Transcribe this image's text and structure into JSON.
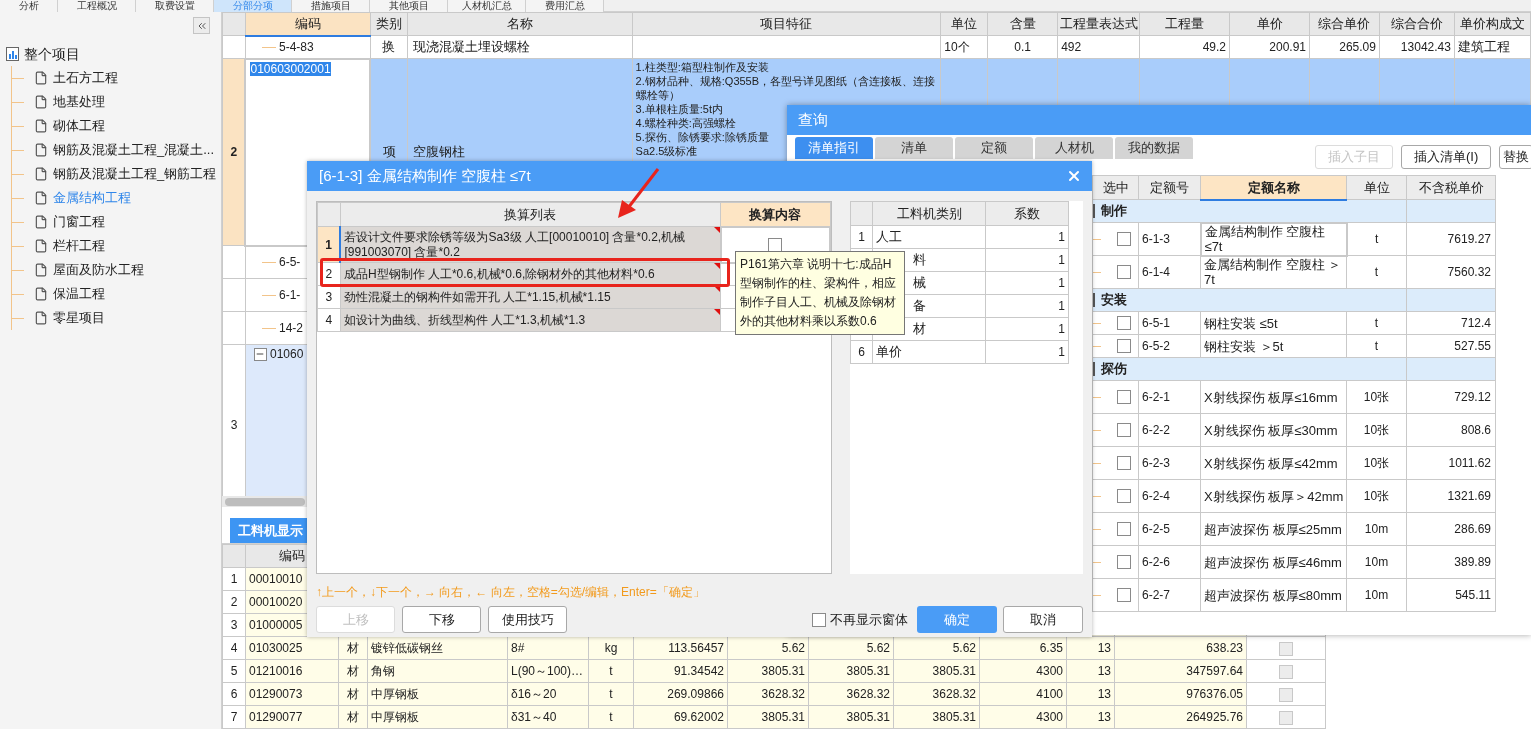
{
  "top_tabs": [
    {
      "label": "分析",
      "selected": false
    },
    {
      "label": "工程概况",
      "selected": false
    },
    {
      "label": "取费设置",
      "selected": false
    },
    {
      "label": "分部分项",
      "selected": true
    },
    {
      "label": "措施项目",
      "selected": false
    },
    {
      "label": "其他项目",
      "selected": false
    },
    {
      "label": "人材机汇总",
      "selected": false
    },
    {
      "label": "费用汇总",
      "selected": false
    }
  ],
  "sidebar": {
    "tree": [
      {
        "label": "整个项目",
        "selected": false,
        "children": [
          {
            "label": "土石方工程",
            "selected": false
          },
          {
            "label": "地基处理",
            "selected": false
          },
          {
            "label": "砌体工程",
            "selected": false
          },
          {
            "label": "钢筋及混凝土工程_混凝土...",
            "selected": false
          },
          {
            "label": "钢筋及混凝土工程_钢筋工程",
            "selected": false
          },
          {
            "label": "金属结构工程",
            "selected": true
          },
          {
            "label": "门窗工程",
            "selected": false
          },
          {
            "label": "栏杆工程",
            "selected": false
          },
          {
            "label": "屋面及防水工程",
            "selected": false
          },
          {
            "label": "保温工程",
            "selected": false
          },
          {
            "label": "零星项目",
            "selected": false
          }
        ]
      }
    ]
  },
  "main_grid": {
    "columns": [
      "编码",
      "类别",
      "名称",
      "项目特征",
      "单位",
      "含量",
      "工程量表达式",
      "工程量",
      "单价",
      "综合单价",
      "综合合价",
      "单价构成文"
    ],
    "rows": [
      {
        "kind": "sub",
        "code": "5-4-83",
        "type": "换",
        "name": "现浇混凝土埋设螺栓",
        "unit": "10个",
        "content": "0.1",
        "expression": "492",
        "quantity": "49.2",
        "price": "200.91",
        "unit_price": "265.09",
        "total": "13042.43",
        "file": "建筑工程",
        "selected": false
      },
      {
        "kind": "item",
        "num": "2",
        "code": "010603002001",
        "type": "项",
        "name": "空腹钢柱",
        "features": [
          "1.柱类型:箱型柱制作及安装",
          "2.钢材品种、规格:Q355B，各型号详见图纸（含连接板、连接螺栓等）",
          "3.单根柱质量:5t内",
          "4.螺栓种类:高强螺栓",
          "5.探伤、除锈要求:除锈质量",
          "Sa2.5级标准"
        ],
        "selected": true
      },
      {
        "kind": "sub",
        "code": "6-5-",
        "selected": false
      },
      {
        "kind": "sub",
        "code": "6-1-",
        "selected": false
      },
      {
        "kind": "sub",
        "code": "14-2",
        "selected": false
      },
      {
        "kind": "item",
        "num": "3",
        "code": "01060",
        "expanded": true,
        "selected": false
      }
    ]
  },
  "bottom_panel": {
    "tab": "工料机显示",
    "columns": [
      "编码"
    ],
    "rows": [
      {
        "num": "1",
        "cells": [
          "00010010"
        ]
      },
      {
        "num": "2",
        "cells": [
          "00010020"
        ]
      },
      {
        "num": "3",
        "cells": [
          "01000005"
        ]
      },
      {
        "num": "4",
        "cells": [
          "01030025",
          "材",
          "镀锌低碳钢丝",
          "8#",
          "kg",
          "113.56457",
          "5.62",
          "5.62",
          "5.62",
          "6.35",
          "13",
          "638.23"
        ],
        "checked": false
      },
      {
        "num": "5",
        "cells": [
          "01210016",
          "材",
          "角钢",
          "L(90～100)…",
          "t",
          "91.34542",
          "3805.31",
          "3805.31",
          "3805.31",
          "4300",
          "13",
          "347597.64"
        ],
        "checked": false
      },
      {
        "num": "6",
        "cells": [
          "01290073",
          "材",
          "中厚钢板",
          "δ16～20",
          "t",
          "269.09866",
          "3628.32",
          "3628.32",
          "3628.32",
          "4100",
          "13",
          "976376.05"
        ],
        "checked": false
      },
      {
        "num": "7",
        "cells": [
          "01290077",
          "材",
          "中厚钢板",
          "δ31～40",
          "t",
          "69.62002",
          "3805.31",
          "3805.31",
          "3805.31",
          "4300",
          "13",
          "264925.76"
        ],
        "checked": false
      }
    ]
  },
  "query_window": {
    "title": "查询",
    "tabs": [
      {
        "label": "清单指引",
        "selected": true
      },
      {
        "label": "清单",
        "selected": false
      },
      {
        "label": "定额",
        "selected": false
      },
      {
        "label": "人材机",
        "selected": false
      },
      {
        "label": "我的数据",
        "selected": false
      }
    ],
    "buttons": [
      {
        "label": "插入子目",
        "disabled": true
      },
      {
        "label": "插入清单(I)",
        "disabled": false
      },
      {
        "label": "替换",
        "disabled": false
      }
    ],
    "columns": [
      "选中",
      "定额号",
      "定额名称",
      "单位",
      "不含税单价"
    ],
    "groups": [
      {
        "label": "制作",
        "items": [
          {
            "code": "6-1-3",
            "name": "金属结构制作 空腹柱 ≤7t",
            "unit": "t",
            "price": "7619.27",
            "checked": false,
            "selected": true
          },
          {
            "code": "6-1-4",
            "name": "金属结构制作 空腹柱 ＞7t",
            "unit": "t",
            "price": "7560.32",
            "checked": false,
            "selected": false
          }
        ]
      },
      {
        "label": "安装",
        "items": [
          {
            "code": "6-5-1",
            "name": "钢柱安装 ≤5t",
            "unit": "t",
            "price": "712.4",
            "checked": false,
            "selected": false
          },
          {
            "code": "6-5-2",
            "name": "钢柱安装 ＞5t",
            "unit": "t",
            "price": "527.55",
            "checked": false,
            "selected": false
          }
        ]
      },
      {
        "label": "探伤",
        "items": [
          {
            "code": "6-2-1",
            "name": "X射线探伤 板厚≤16mm",
            "unit": "10张",
            "price": "729.12",
            "checked": false,
            "selected": false
          },
          {
            "code": "6-2-2",
            "name": "X射线探伤 板厚≤30mm",
            "unit": "10张",
            "price": "808.6",
            "checked": false,
            "selected": false
          },
          {
            "code": "6-2-3",
            "name": "X射线探伤 板厚≤42mm",
            "unit": "10张",
            "price": "1011.62",
            "checked": false,
            "selected": false
          },
          {
            "code": "6-2-4",
            "name": "X射线探伤 板厚＞42mm",
            "unit": "10张",
            "price": "1321.69",
            "checked": false,
            "selected": false
          },
          {
            "code": "6-2-5",
            "name": "超声波探伤 板厚≤25mm",
            "unit": "10m",
            "price": "286.69",
            "checked": false,
            "selected": false
          },
          {
            "code": "6-2-6",
            "name": "超声波探伤 板厚≤46mm",
            "unit": "10m",
            "price": "389.89",
            "checked": false,
            "selected": false
          },
          {
            "code": "6-2-7",
            "name": "超声波探伤 板厚≤80mm",
            "unit": "10m",
            "price": "545.11",
            "checked": false,
            "selected": false
          }
        ]
      }
    ]
  },
  "conversion_dialog": {
    "title": "[6-1-3] 金属结构制作 空腹柱 ≤7t",
    "list_columns": [
      "换算列表",
      "换算内容"
    ],
    "rows": [
      {
        "num": "1",
        "text": "若设计文件要求除锈等级为Sa3级 人工[00010010] 含量*0.2,机械[991003070] 含量*0.2",
        "selected": true,
        "checked": false
      },
      {
        "num": "2",
        "text": "成品H型钢制作 人工*0.6,机械*0.6,除钢材外的其他材料*0.6",
        "selected": false
      },
      {
        "num": "3",
        "text": "劲性混凝土的钢构件如需开孔 人工*1.15,机械*1.15",
        "selected": false
      },
      {
        "num": "4",
        "text": "如设计为曲线、折线型构件 人工*1.3,机械*1.3",
        "selected": false
      }
    ],
    "tooltip": "P161第六章 说明十七:成品H型钢制作的柱、梁构件，相应制作子目人工、机械及除钢材外的其他材料乘以系数0.6",
    "factor_columns": [
      "工料机类别",
      "系数"
    ],
    "factors": [
      {
        "num": "1",
        "label": "人工",
        "value": "1"
      },
      {
        "label": "料",
        "value": "1"
      },
      {
        "label": "械",
        "value": "1"
      },
      {
        "label": "备",
        "value": "1"
      },
      {
        "label": "材",
        "value": "1"
      },
      {
        "num": "6",
        "label": "单价",
        "value": "1"
      }
    ],
    "hint": "↑上一个，↓下一个，→ 向右，← 向左，空格=勾选/编辑，Enter=「确定」",
    "left_buttons": [
      {
        "label": "上移",
        "disabled": true
      },
      {
        "label": "下移",
        "disabled": false
      },
      {
        "label": "使用技巧",
        "disabled": false
      }
    ],
    "dont_show": {
      "label": "不再显示窗体",
      "checked": false
    },
    "ok": "确定",
    "cancel": "取消"
  }
}
